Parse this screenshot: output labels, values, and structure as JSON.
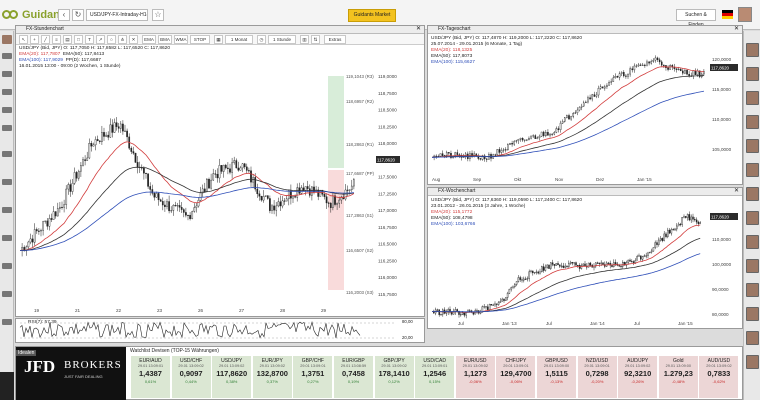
{
  "browser": {
    "logo_text": "Guidants",
    "url_text": "USD/JPY-FX-Intraday-H1-D-W",
    "market_button": "Guidants Market",
    "search_button": "Suchen & Finden"
  },
  "left_chart": {
    "title": "FX-Stundenchart",
    "toolbar": [
      "EMA",
      "BMA",
      "WMA",
      "STOP",
      "1 Monat",
      "1 Stunde",
      "Extras"
    ],
    "legend": {
      "instrument": "USD/JPY (Bid, JPY)  O: 117,7050  H: 117,8582  L: 117,6520  C: 117,8620",
      "ema20": "EMA(20): 117,7807",
      "ema50": "EMA(50): 117,8413",
      "ema100": "EMA(100): 117,9029",
      "pp": "PP(D): 117,6687",
      "range": "16.01.2015 13:00 - 09:00 (2 Wochen, 1 Stunde)"
    },
    "y_ticks": [
      "119,1043 (R3)",
      "118,6957 (R2)",
      "118,2863 (R1)",
      "117,6687 (PP)",
      "117,2863 (S1)",
      "116,6507 (S2)",
      "116,2003 (S3)"
    ],
    "y_axis": [
      "119,0000",
      "118,7500",
      "118,5000",
      "118,2500",
      "118,0000",
      "117,7500",
      "117,5000",
      "117,2500",
      "117,0000",
      "116,7500",
      "116,5000",
      "116,2500",
      "116,0000",
      "115,7500"
    ],
    "x_ticks": [
      "19",
      "21",
      "22",
      "23",
      "26",
      "27",
      "28",
      "29"
    ],
    "last_price": "117,8620",
    "rsi_label": "RSI(7): 57,39",
    "rsi_levels": [
      "80,00",
      "20,00"
    ]
  },
  "top_right_chart": {
    "title": "FX-Tageschart",
    "legend": {
      "instrument": "USD/JPY (Bid, JPY)  O: 117,4870  H: 119,2000  L: 117,2220  C: 117,8620",
      "range": "25.07.2014 - 29.01.2015 (6 Monate, 1 Tag)",
      "ema20": "EMA(20): 118,1325",
      "ema50": "EMA(50): 117,8073",
      "ema100": "EMA(100): 115,6627"
    },
    "y_axis": [
      "120,0000",
      "115,0000",
      "110,0000",
      "105,0000"
    ],
    "x_ticks": [
      "Aug",
      "Sep",
      "Okt",
      "Nov",
      "Dez",
      "Jan '15"
    ],
    "last_price": "117,8620"
  },
  "bottom_right_chart": {
    "title": "FX-Wochenchart",
    "legend": {
      "instrument": "USD/JPY (Bid, JPY)  O: 117,6360  H: 119,0590  L: 117,2400  C: 117,8620",
      "range": "23.01.2012 - 26.01.2015 (3 Jahre, 1 Woche)",
      "ema20": "EMA(20): 115,1772",
      "ema50": "EMA(50): 108,4798",
      "ema100": "EMA(100): 103,6766"
    },
    "y_axis": [
      "110,0000",
      "100,0000",
      "90,0000",
      "80,0000"
    ],
    "x_ticks": [
      "Jul",
      "Jan '13",
      "Jul",
      "Jan '14",
      "Jul",
      "Jan '15"
    ],
    "last_price": "117,8620"
  },
  "brand": {
    "head": "Idealen",
    "name_a": "JFD",
    "name_b": "BROKERS",
    "sub": "JUST FAIR DEALING"
  },
  "quotes_title": "Watchlist Devisen (TOP-15 Währungen)",
  "quotes": [
    {
      "pair": "EUR/AUD",
      "date": "29.01 13:09:01",
      "value": "1,4387",
      "change": "0,61%",
      "dir": "up"
    },
    {
      "pair": "USD/CHF",
      "date": "29.01 13:09:02",
      "value": "0,9097",
      "change": "0,44%",
      "dir": "up"
    },
    {
      "pair": "USD/JPY",
      "date": "29.01 13:09:02",
      "value": "117,8620",
      "change": "0,38%",
      "dir": "up"
    },
    {
      "pair": "EUR/JPY",
      "date": "29.01 13:09:02",
      "value": "132,8700",
      "change": "0,37%",
      "dir": "up"
    },
    {
      "pair": "GBP/CHF",
      "date": "29.01 13:09:01",
      "value": "1,3751",
      "change": "0,27%",
      "dir": "up"
    },
    {
      "pair": "EUR/GBP",
      "date": "29.01 13:08:59",
      "value": "0,7458",
      "change": "0,19%",
      "dir": "up"
    },
    {
      "pair": "GBP/JPY",
      "date": "29.01 13:09:02",
      "value": "178,1410",
      "change": "0,12%",
      "dir": "up"
    },
    {
      "pair": "USD/CAD",
      "date": "29.01 13:09:01",
      "value": "1,2546",
      "change": "0,15%",
      "dir": "up"
    },
    {
      "pair": "EUR/USD",
      "date": "29.01 13:09:02",
      "value": "1,1273",
      "change": "-0,06%",
      "dir": "down"
    },
    {
      "pair": "CHF/JPY",
      "date": "29.01 13:09:01",
      "value": "129,4700",
      "change": "-0,06%",
      "dir": "down"
    },
    {
      "pair": "GBP/USD",
      "date": "29.01 13:09:00",
      "value": "1,5115",
      "change": "-0,13%",
      "dir": "down"
    },
    {
      "pair": "NZD/USD",
      "date": "29.01 13:09:01",
      "value": "0,7298",
      "change": "-0,20%",
      "dir": "down"
    },
    {
      "pair": "AUD/JPY",
      "date": "29.01 13:09:02",
      "value": "92,3210",
      "change": "-0,26%",
      "dir": "down"
    },
    {
      "pair": "Gold",
      "date": "29.01 13:09:00",
      "value": "1.279,23",
      "change": "-0,48%",
      "dir": "down"
    },
    {
      "pair": "AUD/USD",
      "date": "29.01 13:09:02",
      "value": "0,7833",
      "change": "-0,62%",
      "dir": "down"
    }
  ],
  "colors": {
    "candle": "#222222",
    "ema20": "#d23c3c",
    "ema50": "#333333",
    "ema100": "#2f4fb8",
    "pivot_up": "#4caf50",
    "pivot_down": "#e35b5b"
  }
}
